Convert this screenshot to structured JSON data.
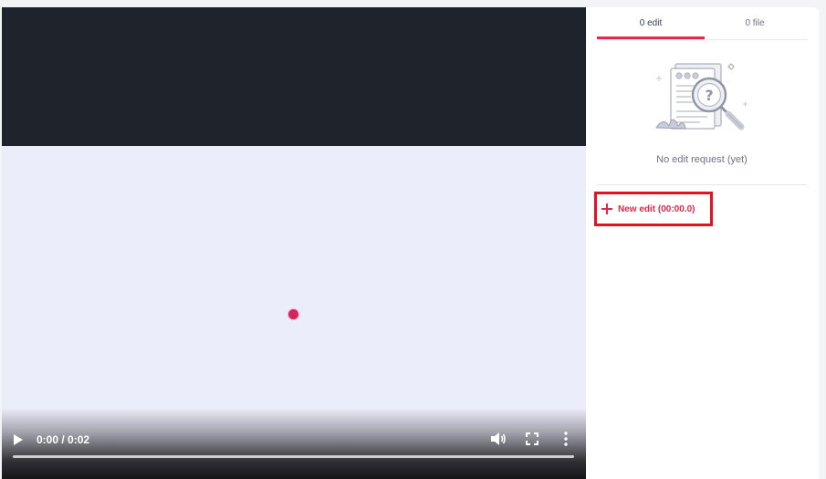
{
  "video": {
    "current_time": "0:00",
    "duration": "0:02",
    "time_display": "0:00 / 0:02",
    "progress": 0,
    "dot_color": "#d6245a",
    "icons": {
      "play": "play-icon",
      "volume": "volume-icon",
      "fullscreen": "fullscreen-icon",
      "menu": "more-vertical-icon"
    }
  },
  "panel": {
    "tabs": [
      {
        "label": "0 edit",
        "active": true
      },
      {
        "label": "0 file",
        "active": false
      }
    ],
    "empty_state": {
      "icon": "document-search-icon",
      "text": "No edit request (yet)"
    },
    "new_edit": {
      "label": "New edit (00:00.0)",
      "icon": "plus-icon"
    }
  },
  "colors": {
    "accent": "#e3284a",
    "highlight_border": "#e3131f",
    "video_bg": "#1f232b",
    "frame_bg": "#ecedfa"
  }
}
